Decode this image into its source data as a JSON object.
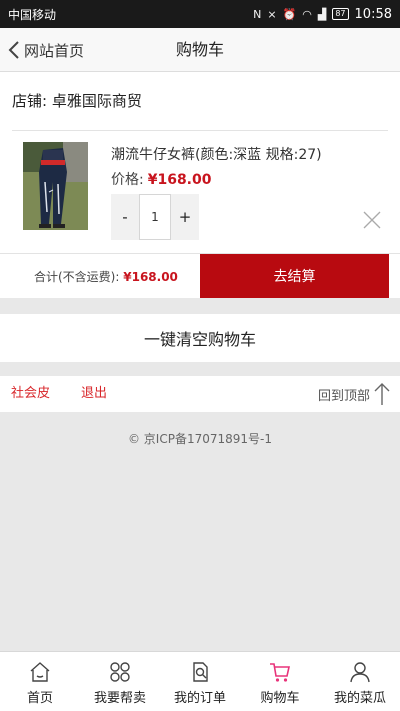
{
  "status_bar": {
    "carrier": "中国移动",
    "battery": "87",
    "time": "10:58"
  },
  "nav": {
    "back_label": "网站首页",
    "title": "购物车"
  },
  "cart": {
    "shop_label": "店铺: 卓雅国际商贸",
    "item": {
      "name": "潮流牛仔女裤(颜色:深蓝 规格:27)",
      "price_label": "价格:",
      "price": "¥168.00",
      "quantity": "1",
      "minus": "-",
      "plus": "+"
    },
    "total_label": "合计(不含运费):",
    "total_amount": "¥168.00",
    "checkout_label": "去结算"
  },
  "clear_cart_label": "一键清空购物车",
  "footer": {
    "user_link": "社会皮",
    "logout_link": "退出",
    "back_to_top": "回到顶部",
    "icp": "© 京ICP备17071891号-1"
  },
  "tabs": [
    {
      "label": "首页",
      "icon": "home-icon"
    },
    {
      "label": "我要帮卖",
      "icon": "grid-icon"
    },
    {
      "label": "我的订单",
      "icon": "order-icon"
    },
    {
      "label": "购物车",
      "icon": "cart-icon"
    },
    {
      "label": "我的菜瓜",
      "icon": "user-icon"
    }
  ],
  "colors": {
    "accent_red": "#b80a10",
    "price_red": "#c8141e",
    "cart_tab_pink": "#e8337a"
  }
}
